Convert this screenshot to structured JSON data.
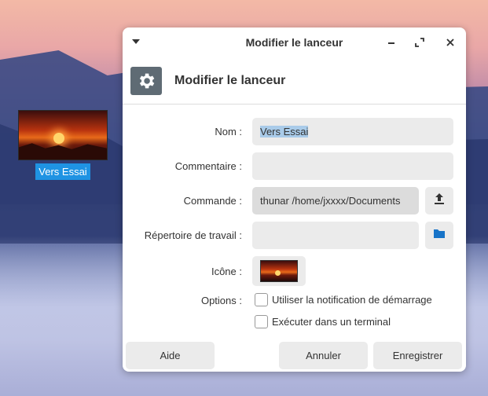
{
  "desktop": {
    "icon_label": "Vers Essai"
  },
  "dialog": {
    "window_title": "Modifier le lanceur",
    "header_title": "Modifier le lanceur",
    "fields": {
      "name_label": "Nom :",
      "name_value": "Vers Essai",
      "comment_label": "Commentaire :",
      "comment_value": "",
      "command_label": "Commande :",
      "command_value": "thunar /home/jxxxx/Documents",
      "workdir_label": "Répertoire de travail :",
      "workdir_value": "",
      "icon_label": "Icône :",
      "options_label": "Options :"
    },
    "options": [
      {
        "label": "Utiliser la notification de démarrage",
        "checked": false
      },
      {
        "label": "Exécuter dans un terminal",
        "checked": false
      }
    ],
    "buttons": {
      "help": "Aide",
      "cancel": "Annuler",
      "save": "Enregistrer"
    },
    "icons": [
      "menu-arrow-icon",
      "minimize-icon",
      "maximize-icon",
      "close-icon",
      "gear-icon",
      "upload-icon",
      "folder-icon"
    ],
    "colors": {
      "accent": "#1f93e3",
      "selection": "#a9cbe9",
      "folder_icon": "#1874c8"
    }
  }
}
